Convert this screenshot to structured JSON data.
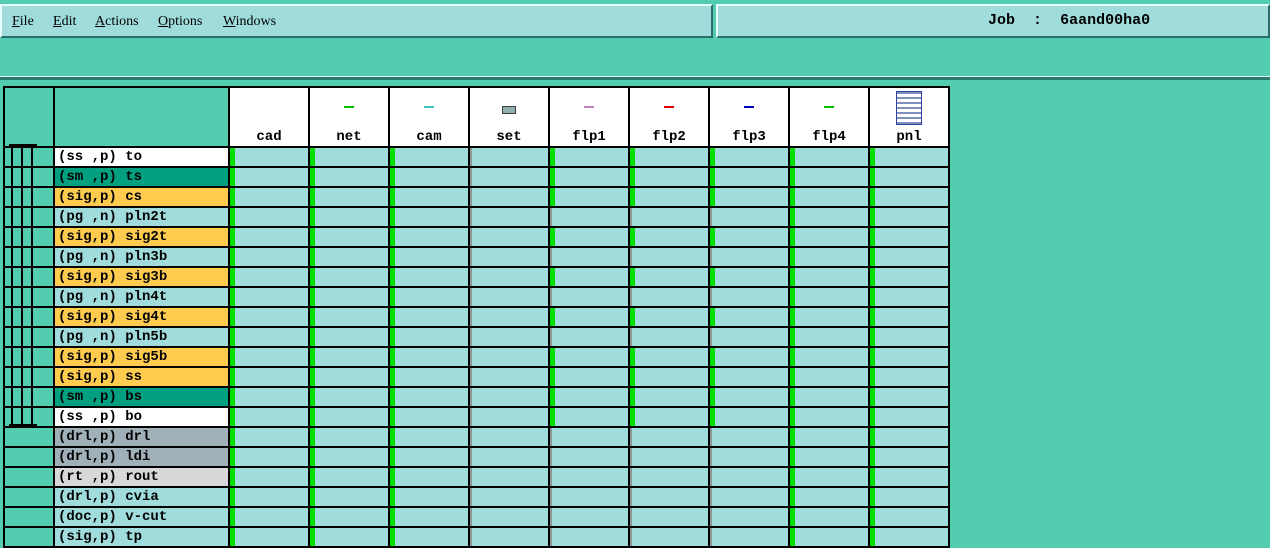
{
  "menu": {
    "items": [
      {
        "first": "F",
        "rest": "ile"
      },
      {
        "first": "E",
        "rest": "dit"
      },
      {
        "first": "A",
        "rest": "ctions"
      },
      {
        "first": "O",
        "rest": "ptions"
      },
      {
        "first": "W",
        "rest": "indows"
      }
    ]
  },
  "job": {
    "label": "Job",
    "separator": ":",
    "name": "6aand00ha0"
  },
  "columns": [
    {
      "label": "cad",
      "icon": "blank-icon",
      "icon_color": "#ffffff"
    },
    {
      "label": "net",
      "icon": "net-icon",
      "icon_color": "#00c000"
    },
    {
      "label": "cam",
      "icon": "cam-icon",
      "icon_color": "#40c0c0"
    },
    {
      "label": "set",
      "icon": "set-icon",
      "icon_color": "#404040"
    },
    {
      "label": "flp1",
      "icon": "flp1-icon",
      "icon_color": "#c080c0"
    },
    {
      "label": "flp2",
      "icon": "flp2-icon",
      "icon_color": "#e00000"
    },
    {
      "label": "flp3",
      "icon": "flp3-icon",
      "icon_color": "#0000c0"
    },
    {
      "label": "flp4",
      "icon": "flp4-icon",
      "icon_color": "#00c000"
    },
    {
      "label": "pnl",
      "icon": "pnl-icon",
      "icon_color": "#3040a0"
    }
  ],
  "rows": [
    {
      "label": "(ss ,p) to",
      "color": "#ffffff",
      "status": "ok,ok,ok,none,ok,ok,ok,ok,ok"
    },
    {
      "label": "(sm ,p) ts",
      "color": "#00a080",
      "status": "ok,ok,ok,none,ok,ok,ok,ok,ok"
    },
    {
      "label": "(sig,p) cs",
      "color": "#ffcc50",
      "status": "ok,ok,ok,none,ok,ok,ok,ok,ok"
    },
    {
      "label": "(pg ,n) pln2t",
      "color": "#a0dcdc",
      "status": "ok,ok,ok,none,none,none,none,ok,ok"
    },
    {
      "label": "(sig,p) sig2t",
      "color": "#ffcc50",
      "status": "ok,ok,ok,none,ok,ok,ok,ok,ok"
    },
    {
      "label": "(pg ,n) pln3b",
      "color": "#a0dcdc",
      "status": "ok,ok,ok,none,none,none,none,ok,ok"
    },
    {
      "label": "(sig,p) sig3b",
      "color": "#ffcc50",
      "status": "ok,ok,ok,none,ok,ok,ok,ok,ok"
    },
    {
      "label": "(pg ,n) pln4t",
      "color": "#a0dcdc",
      "status": "ok,ok,ok,none,none,none,none,ok,ok"
    },
    {
      "label": "(sig,p) sig4t",
      "color": "#ffcc50",
      "status": "ok,ok,ok,none,ok,ok,ok,ok,ok"
    },
    {
      "label": "(pg ,n) pln5b",
      "color": "#a0dcdc",
      "status": "ok,ok,ok,none,none,none,none,ok,ok"
    },
    {
      "label": "(sig,p) sig5b",
      "color": "#ffcc50",
      "status": "ok,ok,ok,none,ok,ok,ok,ok,ok"
    },
    {
      "label": "(sig,p) ss",
      "color": "#ffcc50",
      "status": "ok,ok,ok,none,ok,ok,ok,ok,ok"
    },
    {
      "label": "(sm ,p) bs",
      "color": "#00a080",
      "status": "ok,ok,ok,none,ok,ok,ok,ok,ok"
    },
    {
      "label": "(ss ,p) bo",
      "color": "#ffffff",
      "status": "ok,ok,ok,none,ok,ok,ok,ok,ok"
    },
    {
      "label": "(drl,p) drl",
      "color": "#a0b0b8",
      "status": "ok,ok,ok,none,none,none,none,ok,ok"
    },
    {
      "label": "(drl,p) ldi",
      "color": "#a0b0b8",
      "status": "ok,ok,ok,none,none,none,none,ok,ok"
    },
    {
      "label": "(rt ,p) rout",
      "color": "#d8d8d8",
      "status": "ok,ok,ok,none,none,none,none,ok,ok"
    },
    {
      "label": "(drl,p) cvia",
      "color": "#a0dcdc",
      "status": "ok,ok,ok,none,none,none,none,ok,ok"
    },
    {
      "label": "(doc,p) v-cut",
      "color": "#a0dcdc",
      "status": "ok,ok,ok,none,none,none,none,ok,ok"
    },
    {
      "label": "(sig,p) tp",
      "color": "#a0dcdc",
      "status": "ok,ok,ok,none,none,none,none,ok,ok"
    }
  ]
}
